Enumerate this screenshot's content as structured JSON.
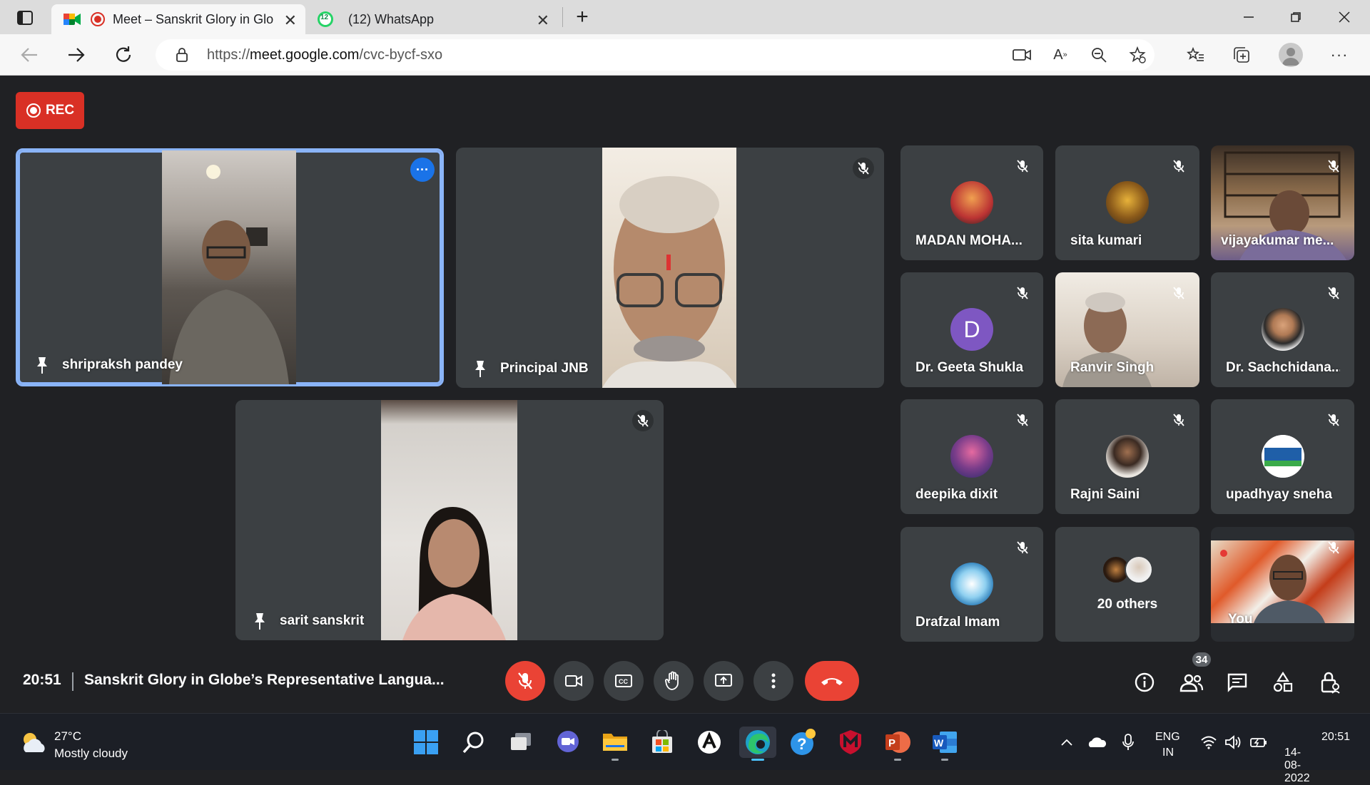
{
  "browser": {
    "tabs": [
      {
        "title": "Meet – Sanskrit Glory in Glo",
        "icon": "google-meet-icon"
      },
      {
        "title": "(12) WhatsApp",
        "icon": "whatsapp-icon",
        "badge": "12"
      }
    ],
    "url_prefix": "https://",
    "url_domain": "meet.google.com",
    "url_path": "/cvc-bycf-sxo"
  },
  "meet": {
    "rec_label": "REC",
    "main_tiles": [
      {
        "name": "shripraksh pandey"
      },
      {
        "name": "Principal JNB"
      },
      {
        "name": "sarit sanskrit"
      }
    ],
    "grid_tiles": [
      {
        "name": "MADAN MOHA..."
      },
      {
        "name": "sita kumari"
      },
      {
        "name": "vijayakumar me..."
      },
      {
        "name": "Dr. Geeta Shukla",
        "initial": "D",
        "color": "#7e57c2"
      },
      {
        "name": "Ranvir Singh"
      },
      {
        "name": "Dr. Sachchidana..."
      },
      {
        "name": "deepika dixit"
      },
      {
        "name": "Rajni Saini"
      },
      {
        "name": "upadhyay sneha"
      },
      {
        "name": "Drafzal Imam"
      },
      {
        "name": "20 others"
      },
      {
        "name": "You"
      }
    ],
    "clock": "20:51",
    "meeting_title": "Sanskrit Glory in Globe’s Representative Langua...",
    "participants_count": "34",
    "colors": {
      "accent": "#8ab4f8",
      "danger": "#ea4335",
      "tile": "#3c4043",
      "background": "#202124"
    }
  },
  "taskbar": {
    "weather_temp": "27°C",
    "weather_desc": "Mostly cloudy",
    "lang_line1": "ENG",
    "lang_line2": "IN",
    "time": "20:51",
    "date": "14-08-2022"
  }
}
